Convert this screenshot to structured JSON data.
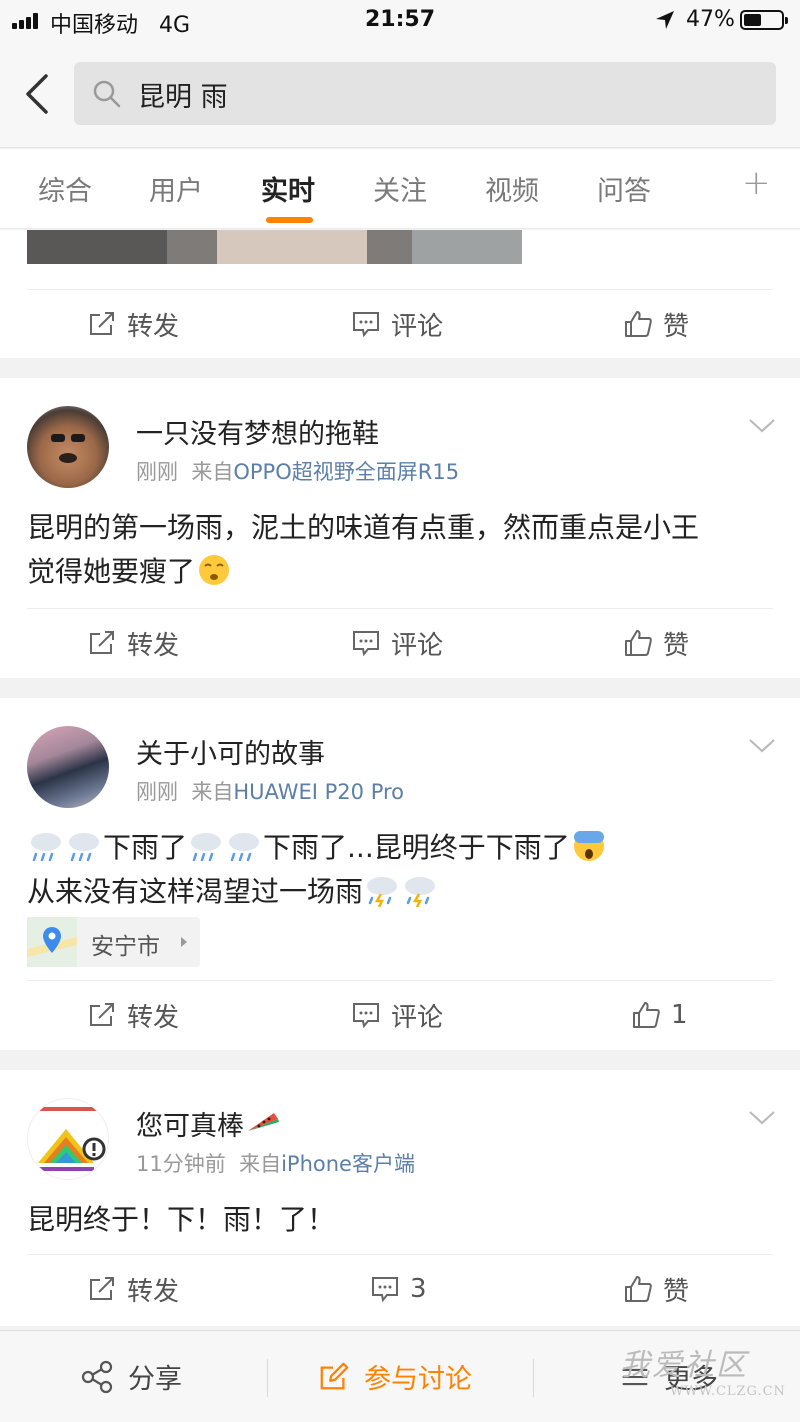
{
  "status_bar": {
    "carrier": "中国移动",
    "network": "4G",
    "time": "21:57",
    "battery": "47%",
    "battery_level": 0.47
  },
  "search": {
    "query": "昆明 雨"
  },
  "tabs": [
    {
      "label": "综合",
      "active": false
    },
    {
      "label": "用户",
      "active": false
    },
    {
      "label": "实时",
      "active": true
    },
    {
      "label": "关注",
      "active": false
    },
    {
      "label": "视频",
      "active": false
    },
    {
      "label": "问答",
      "active": false
    }
  ],
  "tab_more": "+",
  "accent_color": "#ff8200",
  "top_actions": {
    "repost": "转发",
    "comment": "评论",
    "like": "赞"
  },
  "posts": [
    {
      "username": "一只没有梦想的拖鞋",
      "time": "刚刚",
      "from": "来自",
      "source": "OPPO超视野全面屏R15",
      "text_1": "昆明的第一场雨，泥土的味道有点重，然而重点是小王",
      "text_2": "觉得她要瘦了",
      "repost": "转发",
      "comment": "评论",
      "like": "赞"
    },
    {
      "username": "关于小可的故事",
      "time": "刚刚",
      "from": "来自",
      "source": "HUAWEI P20 Pro",
      "text_a": "下雨了",
      "text_b": "下雨了...昆明终于下雨了",
      "text_c": "从来没有这样渴望过一场雨",
      "location": "安宁市",
      "repost": "转发",
      "comment": "评论",
      "like": "1"
    },
    {
      "username": "您可真棒",
      "time": "11分钟前",
      "from": "来自",
      "source": "iPhone客户端",
      "text": "昆明终于！下！雨！了！",
      "repost": "转发",
      "comment": "3",
      "like": "赞"
    }
  ],
  "bottom_bar": {
    "share": "分享",
    "discuss": "参与讨论",
    "more": "更多"
  },
  "watermark": {
    "title": "我爱社区",
    "url": "WWW.CLZG.CN"
  }
}
